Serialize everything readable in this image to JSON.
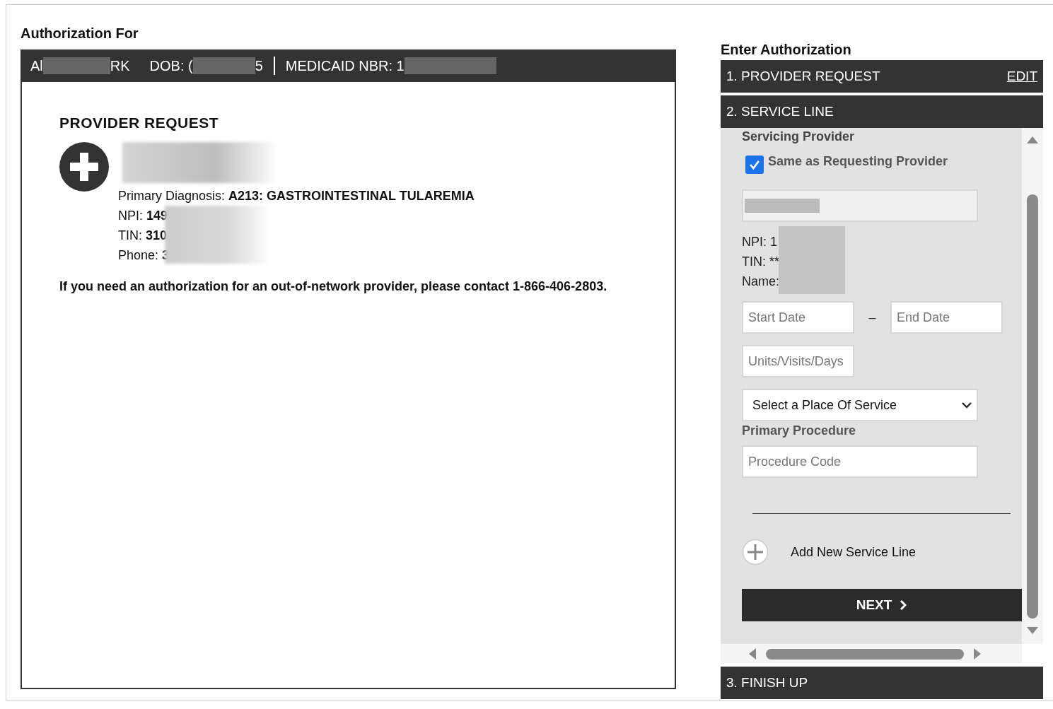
{
  "left": {
    "title": "Authorization For",
    "member_bar": [
      {
        "kind": "text",
        "text": "Al"
      },
      {
        "kind": "redaction"
      },
      {
        "kind": "text",
        "text": "RK"
      },
      {
        "kind": "gap"
      },
      {
        "kind": "text",
        "text": "DOB: ("
      },
      {
        "kind": "redaction"
      },
      {
        "kind": "text",
        "text": "5"
      },
      {
        "kind": "divider"
      },
      {
        "kind": "text",
        "text": "MEDICAID NBR: 1"
      },
      {
        "kind": "redaction"
      }
    ],
    "provider_request": {
      "heading": "PROVIDER REQUEST",
      "diagnosis_label": "Primary Diagnosis:",
      "diagnosis": "A213: GASTROINTESTINAL TULAREMIA",
      "fields": [
        {
          "label": "NPI:",
          "value": "149"
        },
        {
          "label": "TIN:",
          "value": "310"
        },
        {
          "label": "Phone:",
          "value": "3"
        }
      ]
    },
    "notice": "If you need an authorization for an out-of-network provider, please contact 1-866-406-2803."
  },
  "right": {
    "title": "Enter Authorization",
    "sections": [
      {
        "title": "1. PROVIDER REQUEST",
        "action": "EDIT",
        "expanded": false
      },
      {
        "title": "2. SERVICE LINE",
        "expanded": true
      },
      {
        "title": "3. FINISH UP",
        "expanded": false
      }
    ],
    "service_line": {
      "servicing_provider": "Servicing Provider",
      "same_as_requesting": {
        "label": "Same as Requesting Provider",
        "checked": true
      },
      "provider_info": [
        "NPI: 1",
        "TIN: **",
        "Name:"
      ],
      "start_date": {
        "placeholder": "Start Date"
      },
      "date_separator": "–",
      "end_date": {
        "placeholder": "End Date"
      },
      "units": {
        "placeholder": "Units/Visits/Days"
      },
      "place_of_service": "Select a Place Of Service",
      "primary_procedure": "Primary Procedure",
      "procedure_code": {
        "placeholder": "Procedure Code"
      },
      "add_line": "Add New Service Line",
      "next": "NEXT"
    }
  }
}
